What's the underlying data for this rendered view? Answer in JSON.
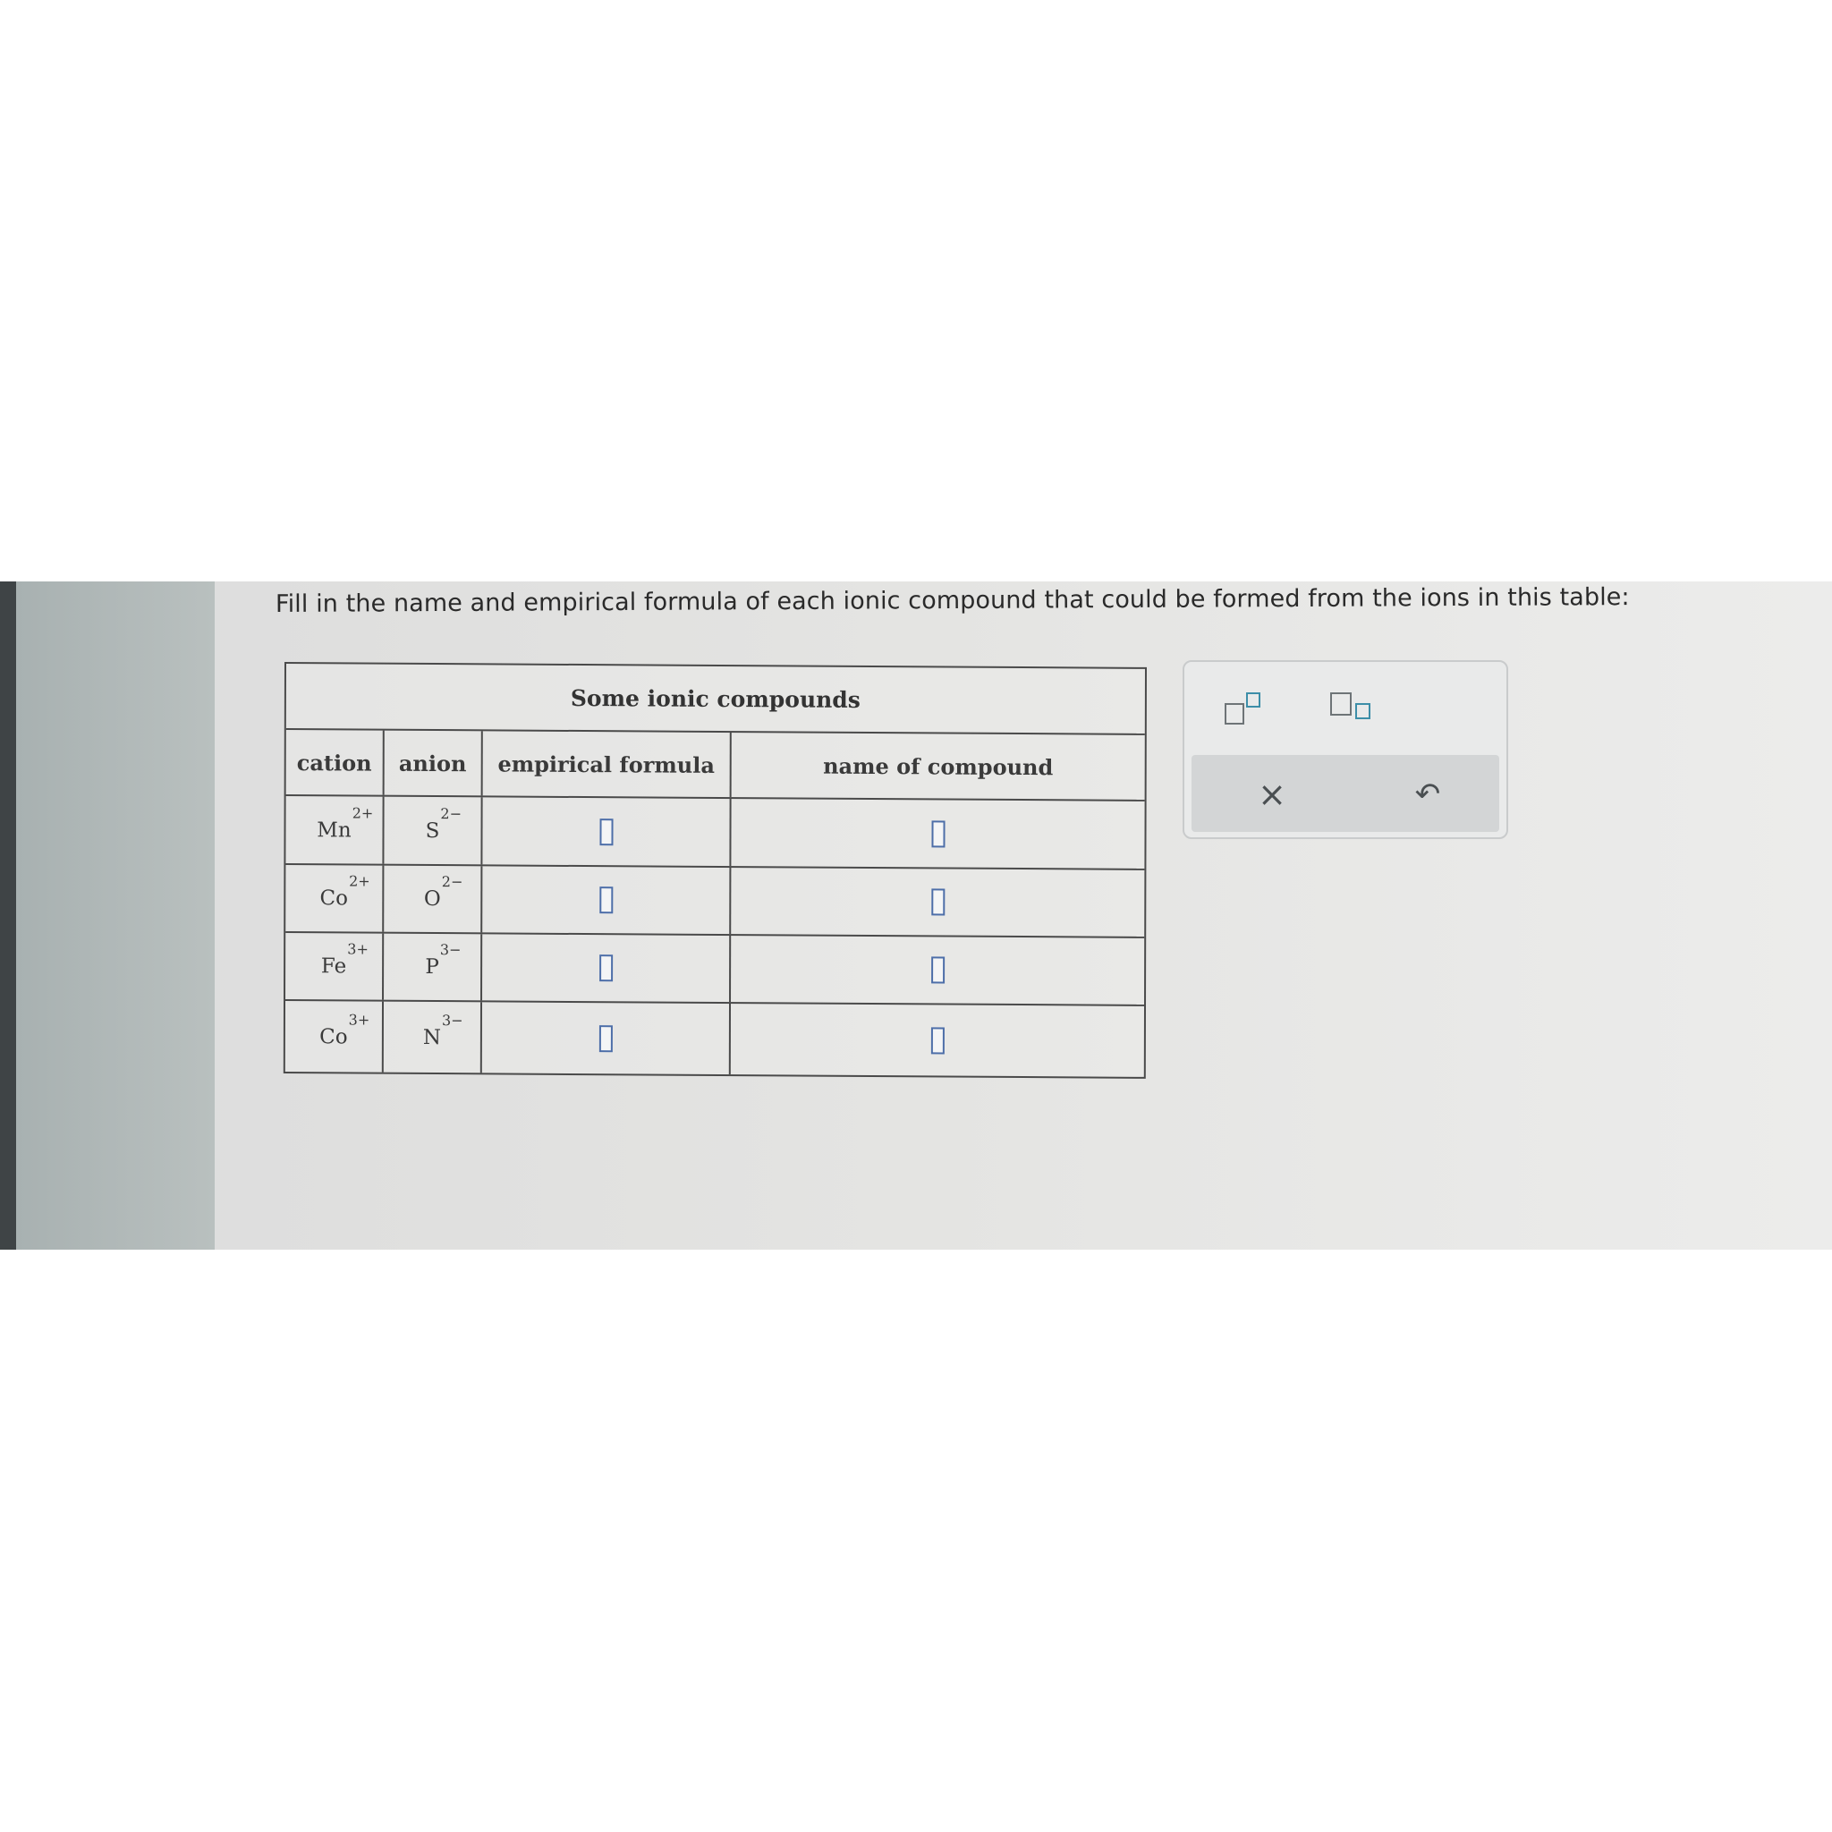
{
  "instruction": "Fill in the name and empirical formula of each ionic compound that could be formed from the ions in this table:",
  "table": {
    "caption": "Some ionic compounds",
    "headers": {
      "cation": "cation",
      "anion": "anion",
      "formula": "empirical formula",
      "name": "name of compound"
    },
    "rows": [
      {
        "cation": "Mn",
        "cation_charge": "2+",
        "anion": "S",
        "anion_charge": "2−",
        "formula": "",
        "name": ""
      },
      {
        "cation": "Co",
        "cation_charge": "2+",
        "anion": "O",
        "anion_charge": "2−",
        "formula": "",
        "name": ""
      },
      {
        "cation": "Fe",
        "cation_charge": "3+",
        "anion": "P",
        "anion_charge": "3−",
        "formula": "",
        "name": ""
      },
      {
        "cation": "Co",
        "cation_charge": "3+",
        "anion": "N",
        "anion_charge": "3−",
        "formula": "",
        "name": ""
      }
    ]
  },
  "toolbar": {
    "superscript_icon": "superscript-template-icon",
    "subscript_icon": "subscript-template-icon",
    "clear_glyph": "×",
    "undo_glyph": "↶"
  },
  "colors": {
    "input_border": "#4d6ea8",
    "template_accent": "#3d8ea8"
  }
}
